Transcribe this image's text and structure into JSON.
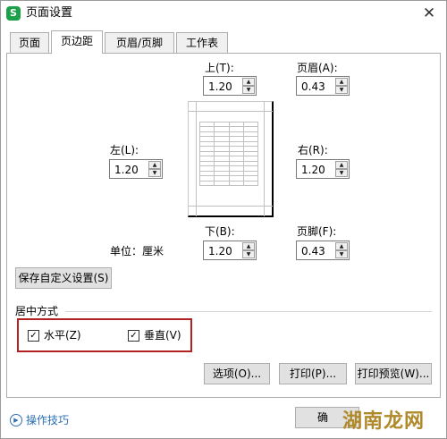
{
  "window": {
    "title": "页面设置",
    "app_icon": "S",
    "close": "✕"
  },
  "tabs": [
    "页面",
    "页边距",
    "页眉/页脚",
    "工作表"
  ],
  "margins": {
    "top": {
      "label": "上(T):",
      "value": "1.20"
    },
    "header": {
      "label": "页眉(A):",
      "value": "0.43"
    },
    "left": {
      "label": "左(L):",
      "value": "1.20"
    },
    "right": {
      "label": "右(R):",
      "value": "1.20"
    },
    "bottom": {
      "label": "下(B):",
      "value": "1.20"
    },
    "footer": {
      "label": "页脚(F):",
      "value": "0.43"
    }
  },
  "unit_label": "单位：厘米",
  "save_custom_label": "保存自定义设置(S)",
  "center_group": {
    "title": "居中方式",
    "horizontal": {
      "label": "水平(Z)",
      "checked": true
    },
    "vertical": {
      "label": "垂直(V)",
      "checked": true
    },
    "highlight_color": "#b22222"
  },
  "buttons": {
    "options": "选项(O)...",
    "print": "打印(P)...",
    "print_preview": "打印预览(W)...",
    "ok": "确"
  },
  "tips": {
    "label": "操作技巧",
    "icon": "play-circle-icon"
  },
  "watermark": "湖南龙网",
  "colors": {
    "app_icon": "#1ba14a",
    "link": "#2b6fb3",
    "watermark": "#b08a2a"
  }
}
